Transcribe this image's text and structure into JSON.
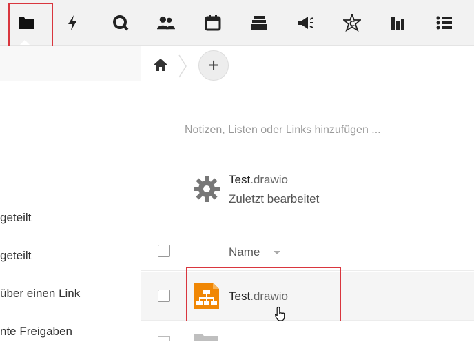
{
  "topbar": {
    "apps": [
      {
        "icon": "files-folder-icon"
      },
      {
        "icon": "activity-lightning-icon"
      },
      {
        "icon": "talk-chat-icon"
      },
      {
        "icon": "contacts-icon"
      },
      {
        "icon": "calendar-icon"
      },
      {
        "icon": "deck-stack-icon"
      },
      {
        "icon": "announcements-megaphone-icon"
      },
      {
        "icon": "circles-star-icon"
      },
      {
        "icon": "analytics-bars-icon"
      },
      {
        "icon": "tasks-list-icon"
      }
    ],
    "active_app": "files"
  },
  "sidebar": {
    "items": [
      {
        "label": " geteilt"
      },
      {
        "label": "geteilt"
      },
      {
        "label": "über einen Link"
      },
      {
        "label": "nte Freigaben"
      }
    ]
  },
  "breadcrumb": {
    "home_icon": "home-icon",
    "add_label": "+"
  },
  "notes": {
    "placeholder": "Notizen, Listen oder Links hinzufügen ..."
  },
  "recent": {
    "icon": "gear-icon",
    "name_base": "Test",
    "name_ext": ".drawio",
    "status": "Zuletzt bearbeitet"
  },
  "file_list": {
    "column_name": "Name",
    "files": [
      {
        "name_base": "Test",
        "name_ext": ".drawio",
        "icon": "drawio-file-icon"
      }
    ]
  },
  "colors": {
    "accent": "#d9363e",
    "drawio": "#f08705",
    "topbar": "#f2f2f2"
  }
}
